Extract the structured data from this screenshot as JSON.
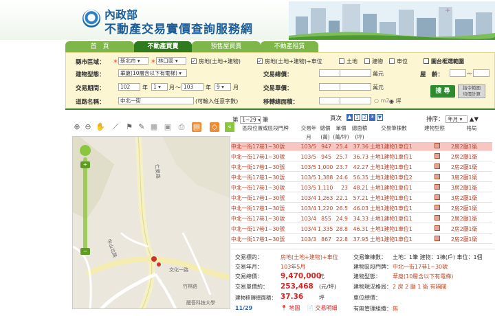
{
  "site": {
    "org": "內政部",
    "title": "不動產交易實價查詢服務網"
  },
  "nav": {
    "tabs": [
      "首　頁",
      "不動產買賣",
      "預售屋買賣",
      "不動產租賃"
    ]
  },
  "search": {
    "county_label": "縣市區域：",
    "county_value": "新北市",
    "district_value": "林口區",
    "type_options": [
      "房地(土地+建物)",
      "房地(土地+建物)+車位",
      "土地",
      "建物",
      "車位"
    ],
    "map_range_label": "圖台框選範圍",
    "building_type_label": "建物型態：",
    "building_type_value": "華廈(10層含以下有電梯)",
    "total_price_label": "交易總價：",
    "unit_wan": "萬元",
    "age_label": "屋　齡：",
    "period_label": "交易期間：",
    "period": {
      "from_year": "102",
      "from_month": "1",
      "to_year": "103",
      "to_month": "9",
      "year_unit": "年",
      "month_unit": "月",
      "tilde": "～"
    },
    "unit_price_label": "交易單價：",
    "road_label": "道路名稱：",
    "road_value": "中北一街",
    "road_hint": "(可輸入任意字數)",
    "area_label": "移轉總面積：",
    "area_units": [
      "m2",
      "坪"
    ],
    "search_button": "搜 尋",
    "calc_button": "指令範圍\n均價計算"
  },
  "result": {
    "range": "1~29",
    "range_prefix": "第",
    "range_suffix": "筆",
    "page_label": "頁次",
    "pages": [
      "1",
      "2",
      "3"
    ],
    "current_page": "3",
    "sort_label": "排序：",
    "sort_value": "年月"
  },
  "chart_data": {
    "type": "table",
    "columns": [
      "區段位置或區段門牌",
      "交易年月",
      "總價(萬)",
      "單價(萬/坪)",
      "總面積(坪)",
      "交易筆棟數",
      "建物型態",
      "格局"
    ],
    "rows": [
      [
        "中北一街17巷1~30號",
        "103/5",
        947,
        25.4,
        37.36,
        "土地1建物1車位1",
        "",
        "2房2廳1衛"
      ],
      [
        "中北一街17巷1~30號",
        "103/5",
        945,
        25.7,
        36.73,
        "土地1建物1車位1",
        "",
        "2房2廳1衛"
      ],
      [
        "中北一街17巷1~30號",
        "103/5",
        1000,
        23.7,
        42.27,
        "土地1建物1車位1",
        "",
        "2房2廳1衛"
      ],
      [
        "中北一街17巷1~30號",
        "103/5",
        1388,
        24.6,
        56.35,
        "土地1建物1車位2",
        "",
        "3房2廳1衛"
      ],
      [
        "中北一街17巷1~30號",
        "103/5",
        1110,
        23,
        48.21,
        "土地1建物1車位1",
        "",
        "3房2廳1衛"
      ],
      [
        "中北一街17巷1~30號",
        "103/4",
        1263,
        22.1,
        57.21,
        "土地1建物1車位1",
        "",
        "3房2廳1衛"
      ],
      [
        "中北一街17巷1~30號",
        "103/4",
        1220,
        26.5,
        46.03,
        "土地1建物1車位1",
        "",
        "2房2廳1衛"
      ],
      [
        "中北一街17巷1~30號",
        "103/4",
        855,
        24.9,
        34.33,
        "土地1建物1車位1",
        "",
        "2房2廳1衛"
      ],
      [
        "中北一街17巷1~30號",
        "103/4",
        1335,
        28.8,
        46.31,
        "土地1建物1車位1",
        "",
        "2房2廳1衛"
      ],
      [
        "中北一街17巷1~30號",
        "103/3",
        867,
        22.8,
        37.95,
        "土地1建物1車位1",
        "",
        "2房2廳1衛"
      ]
    ],
    "highlight_row": 0
  },
  "map": {
    "roads": [
      "仁愛路",
      "文化一路",
      "中山北路",
      "竹林路"
    ],
    "school": "醒吾科技大學"
  },
  "detail": {
    "target_label": "交易標的：",
    "target_value": "房地(土地+建物)+車位",
    "count_label": "交易筆棟數：",
    "count_value": "土地：1筆 建物：1棟(戶) 車位：1個",
    "date_label": "交易年月：",
    "date_value": "103年5月",
    "address_label": "建物區段門牌：",
    "address_value": "中北一街17巷1~30號",
    "total_label": "交易總價：",
    "total_value": "9,470,000",
    "total_unit": "元",
    "type_label": "建物型態：",
    "type_value": "華廈(10層含以下有電梯)",
    "unit_label": "交易單價約：",
    "unit_value": "253,468",
    "unit_unit": "(元/坪)",
    "layout_label": "建物現況格局：",
    "layout_value": "2 房 2 廳 1 衛 有隔間",
    "area_label": "建物移轉總面積：",
    "area_value": "37.36",
    "area_unit": "坪",
    "parking_label": "車位總價：",
    "mgmt_label": "有無管理組織：",
    "mgmt_value": "無",
    "counter": "11/29",
    "map_link": "地圖",
    "detail_link": "交易明細"
  },
  "colors": {
    "brand_green": "#2e7a1c",
    "tab_green": "#7fb64a",
    "row_highlight": "#f8c6c0",
    "value_red": "#c24a2a"
  }
}
